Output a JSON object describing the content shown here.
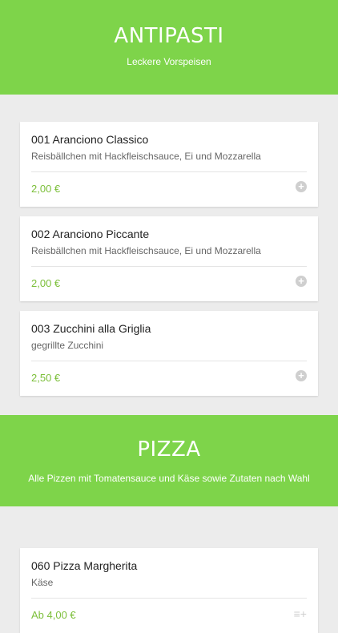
{
  "sections": [
    {
      "title": "ANTIPASTI",
      "subtitle": "Leckere Vorspeisen",
      "items": [
        {
          "name": "001 Aranciono Classico",
          "desc": "Reisbällchen mit Hackfleischsauce, Ei und Mozzarella",
          "price": "2,00 €"
        },
        {
          "name": "002 Aranciono Piccante",
          "desc": "Reisbällchen mit Hackfleischsauce, Ei und Mozzarella",
          "price": "2,00 €"
        },
        {
          "name": "003 Zucchini alla Griglia",
          "desc": "gegrillte Zucchini",
          "price": "2,50 €"
        }
      ]
    },
    {
      "title": "PIZZA",
      "subtitle": "Alle Pizzen mit Tomatensauce und Käse sowie Zutaten nach Wahl",
      "items": [
        {
          "name": "060 Pizza Margherita",
          "desc": "Käse",
          "price": "Ab 4,00 €"
        }
      ]
    }
  ],
  "icons": {
    "add": "plus-circle-icon",
    "options": "list-add-icon"
  },
  "colors": {
    "accent": "#7ed44a",
    "price": "#7cbf3a"
  }
}
